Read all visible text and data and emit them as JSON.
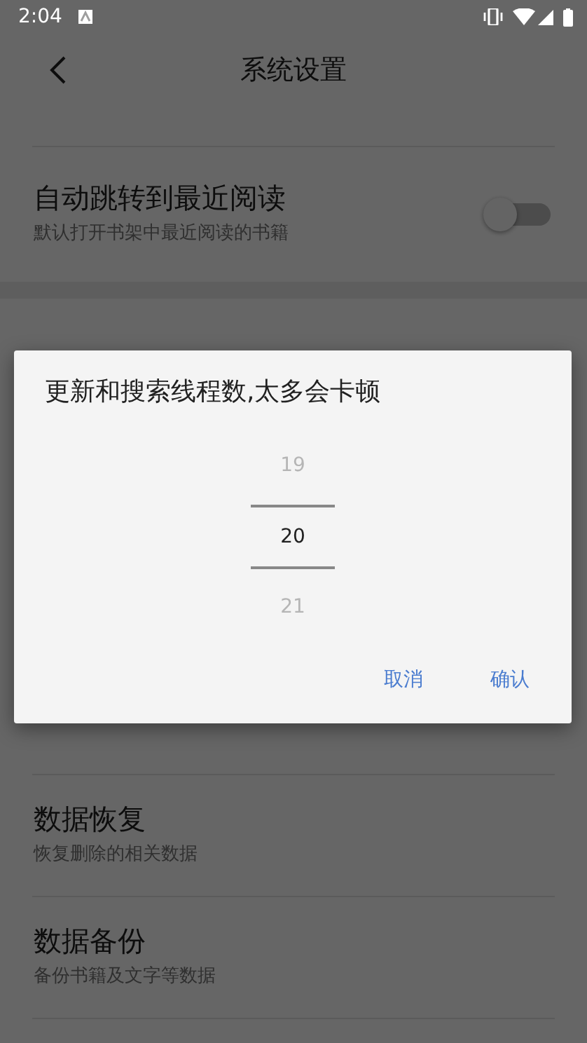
{
  "status_bar": {
    "time": "2:04"
  },
  "toolbar": {
    "title": "系统设置"
  },
  "settings": [
    {
      "kind": "toggle",
      "title": "自动跳转到最近阅读",
      "subtitle": "默认打开书架中最近阅读的书籍",
      "on": false
    },
    {
      "kind": "gap"
    },
    {
      "kind": "item",
      "title": "数据恢复",
      "subtitle": "恢复删除的相关数据"
    },
    {
      "kind": "item",
      "title": "数据备份",
      "subtitle": "备份书籍及文字等数据"
    }
  ],
  "dialog": {
    "title": "更新和搜索线程数,太多会卡顿",
    "picker": [
      {
        "value": "19",
        "selected": false
      },
      {
        "value": "20",
        "selected": true
      },
      {
        "value": "21",
        "selected": false
      }
    ],
    "buttons": [
      "取消",
      "确认"
    ]
  }
}
